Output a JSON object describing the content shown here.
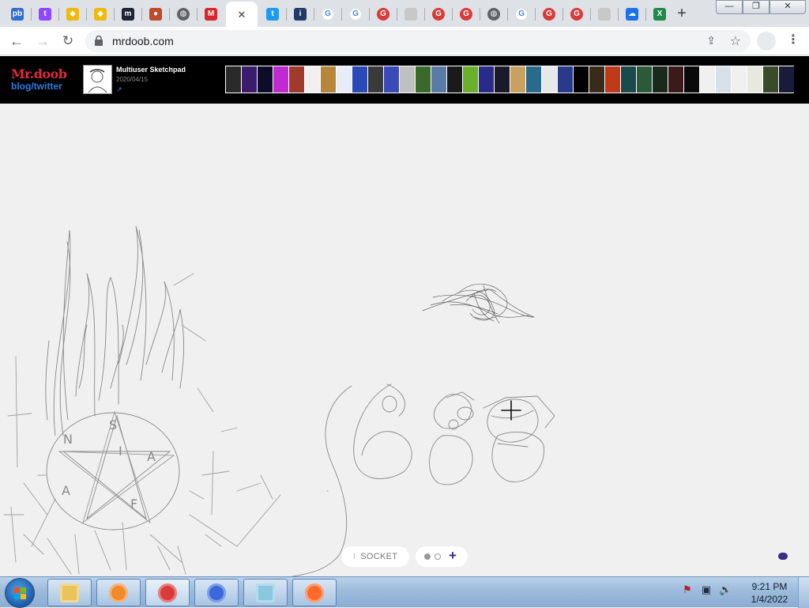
{
  "browser": {
    "tabs": [
      {
        "icon": "pb-icon",
        "text": "pb",
        "color": "#2e6fd0"
      },
      {
        "icon": "twitch-icon",
        "text": "t",
        "color": "#9146ff"
      },
      {
        "icon": "binance-icon",
        "text": "◆",
        "color": "#f0b90b"
      },
      {
        "icon": "binance-icon",
        "text": "◆",
        "color": "#f0b90b"
      },
      {
        "icon": "mastodon-icon",
        "text": "m",
        "color": "#1f2433"
      },
      {
        "icon": "bear-icon",
        "text": "●",
        "color": "#c04a2a"
      },
      {
        "icon": "globe-icon",
        "text": "◍",
        "color": "#5f6368"
      },
      {
        "icon": "mega-icon",
        "text": "M",
        "color": "#d9272e"
      },
      {
        "icon": "close-icon",
        "text": "✕",
        "color": "#ffffff",
        "active": true
      },
      {
        "icon": "twitter-icon",
        "text": "t",
        "color": "#1d9bf0"
      },
      {
        "icon": "info-icon",
        "text": "i",
        "color": "#1f3a6b"
      },
      {
        "icon": "google-icon",
        "text": "G",
        "color": "#ffffff"
      },
      {
        "icon": "google-icon",
        "text": "G",
        "color": "#ffffff"
      },
      {
        "icon": "g-red-icon",
        "text": "G",
        "color": "#d93a3a"
      },
      {
        "icon": "blank-icon",
        "text": "",
        "color": "#c8c8c8"
      },
      {
        "icon": "g-red-icon",
        "text": "G",
        "color": "#d93a3a"
      },
      {
        "icon": "g-red-icon",
        "text": "G",
        "color": "#d93a3a"
      },
      {
        "icon": "globe-icon",
        "text": "◍",
        "color": "#5f6368"
      },
      {
        "icon": "google-icon",
        "text": "G",
        "color": "#ffffff"
      },
      {
        "icon": "g-red-icon",
        "text": "G",
        "color": "#d93a3a"
      },
      {
        "icon": "g-red-icon",
        "text": "G",
        "color": "#d93a3a"
      },
      {
        "icon": "blank-icon",
        "text": "",
        "color": "#c8c8c8"
      },
      {
        "icon": "cloud-upload-icon",
        "text": "☁",
        "color": "#1a73e8"
      },
      {
        "icon": "excel-icon",
        "text": "X",
        "color": "#1d8a4a"
      }
    ],
    "new_tab": "+",
    "window": {
      "minimize": "—",
      "restore": "❐",
      "close": "✕"
    },
    "url": "mrdoob.com"
  },
  "doob": {
    "logo": "Mr.doob",
    "blog_link": "blog/twitter",
    "project_title": "Multiuser Sketchpad",
    "project_date": "2020/04/15",
    "project_link_icon": "↗"
  },
  "strip_colors": [
    "#2a2a2a",
    "#3a1c6a",
    "#0d0d2a",
    "#c02ad0",
    "#a03a2a",
    "#f0f0f0",
    "#b8863a",
    "#e8ecf8",
    "#2a4ab8",
    "#3a3a3a",
    "#3a4ab8",
    "#c0c0c0",
    "#3a6a2a",
    "#5a7aa8",
    "#1a1a1a",
    "#6ab02a",
    "#2a2a8a",
    "#1a1a2a",
    "#c8a060",
    "#2a6a8a",
    "#e8e8e8",
    "#2a3a8a",
    "#000000",
    "#3a2a1a",
    "#c03a1a",
    "#1a4a4a",
    "#2a5a3a",
    "#1a2a1a",
    "#3a1a1a",
    "#0a0a0a",
    "#f0f0f0",
    "#d8e0e8",
    "#f0f0f0",
    "#e8e8e0",
    "#3a4a2a",
    "#1a1a3a"
  ],
  "socket": {
    "label": "SOCKET",
    "icon": "socket-icon"
  },
  "plus_label": "+",
  "taskbar": {
    "apps": [
      {
        "name": "explorer-icon",
        "color": "#e8c45a"
      },
      {
        "name": "media-player-icon",
        "color": "#f08a2a"
      },
      {
        "name": "chrome-icon",
        "color": "#d93a3a"
      },
      {
        "name": "keepass-icon",
        "color": "#3a6ad9"
      },
      {
        "name": "notepad-icon",
        "color": "#8ac8e0"
      },
      {
        "name": "firefox-icon",
        "color": "#ff6a2a"
      }
    ],
    "time": "9:21 PM",
    "date": "1/4/2022"
  },
  "colors": {
    "accent_purple": "#3a2a8a",
    "doob_red": "#e02b3a",
    "doob_blue": "#2d7be0"
  }
}
